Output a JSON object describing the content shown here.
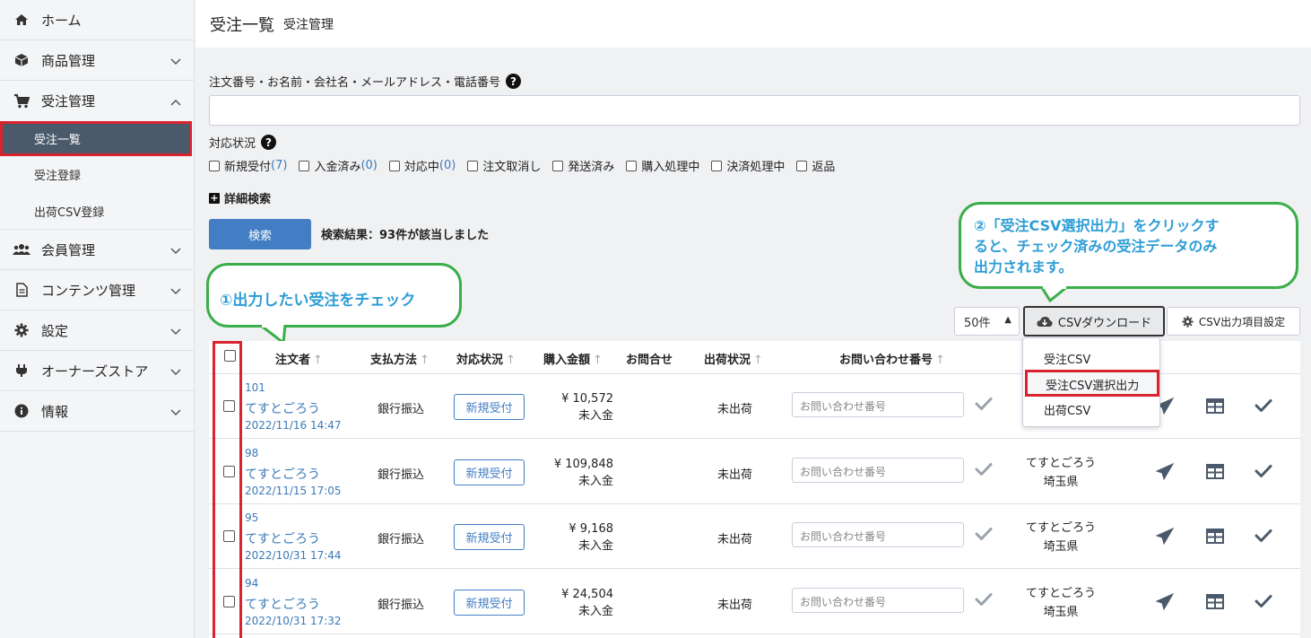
{
  "sidebar": {
    "home": "ホーム",
    "products": "商品管理",
    "orders": "受注管理",
    "order_list": "受注一覧",
    "order_register": "受注登録",
    "shipping_csv": "出荷CSV登録",
    "members": "会員管理",
    "contents": "コンテンツ管理",
    "settings": "設定",
    "owners_store": "オーナーズストア",
    "info": "情報"
  },
  "header": {
    "title": "受注一覧",
    "subtitle": "受注管理"
  },
  "search": {
    "label": "注文番号・お名前・会社名・メールアドレス・電話番号",
    "value": ""
  },
  "status": {
    "label": "対応状況",
    "options": [
      {
        "label": "新規受付",
        "count": "(7)"
      },
      {
        "label": "入金済み",
        "count": "(0)"
      },
      {
        "label": "対応中",
        "count": "(0)"
      },
      {
        "label": "注文取消し",
        "count": ""
      },
      {
        "label": "発送済み",
        "count": ""
      },
      {
        "label": "購入処理中",
        "count": ""
      },
      {
        "label": "決済処理中",
        "count": ""
      },
      {
        "label": "返品",
        "count": ""
      }
    ]
  },
  "advanced_search": "詳細検索",
  "search_button": "検索",
  "result_text": "検索結果：93件が該当しました",
  "callouts": {
    "one": "①出力したい受注をチェック",
    "two_l1": "②「受注CSV選択出力」をクリックす",
    "two_l2": "ると、チェック済みの受注データのみ",
    "two_l3": "出力されます。"
  },
  "toolbar": {
    "per_page": "50件",
    "csv_download": "CSVダウンロード",
    "csv_settings": "CSV出力項目設定"
  },
  "dropdown": {
    "item1": "受注CSV",
    "item2": "受注CSV選択出力",
    "item3": "出荷CSV"
  },
  "table": {
    "headers": {
      "orderer": "注文者",
      "payment": "支払方法",
      "status": "対応状況",
      "amount": "購入金額",
      "inquiry": "お問合せ",
      "shipping": "出荷状況",
      "tracking": "お問い合わせ番号"
    },
    "tracking_placeholder": "お問い合わせ番号",
    "rows": [
      {
        "id": "101",
        "name": "てすとごろう",
        "date": "2022/11/16 14:47",
        "payment": "銀行振込",
        "status": "新規受付",
        "amount": "¥ 10,572",
        "paid": "未入金",
        "ship": "未出荷",
        "dest_name": "",
        "dest_pref": ""
      },
      {
        "id": "98",
        "name": "てすとごろう",
        "date": "2022/11/15 17:05",
        "payment": "銀行振込",
        "status": "新規受付",
        "amount": "¥ 109,848",
        "paid": "未入金",
        "ship": "未出荷",
        "dest_name": "てすとごろう",
        "dest_pref": "埼玉県"
      },
      {
        "id": "95",
        "name": "てすとごろう",
        "date": "2022/10/31 17:44",
        "payment": "銀行振込",
        "status": "新規受付",
        "amount": "¥ 9,168",
        "paid": "未入金",
        "ship": "未出荷",
        "dest_name": "てすとごろう",
        "dest_pref": "埼玉県"
      },
      {
        "id": "94",
        "name": "てすとごろう",
        "date": "2022/10/31 17:32",
        "payment": "銀行振込",
        "status": "新規受付",
        "amount": "¥ 24,504",
        "paid": "未入金",
        "ship": "未出荷",
        "dest_name": "てすとごろう",
        "dest_pref": "埼玉県"
      }
    ]
  },
  "colors": {
    "accent": "#437ec4",
    "link": "#3a7ab8",
    "highlight_red": "#d9232e",
    "callout_green": "#3aae4a",
    "callout_text": "#2e9dd6",
    "sidebar_active": "#4b5a6b"
  }
}
